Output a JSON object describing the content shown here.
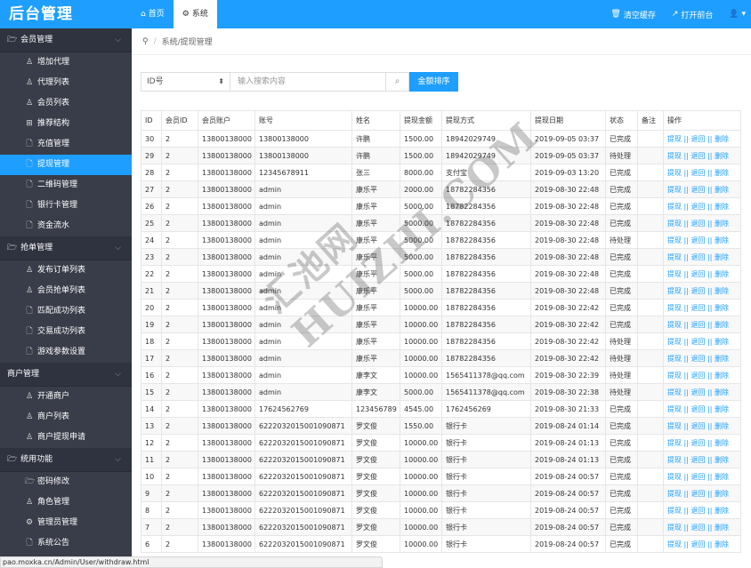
{
  "header": {
    "logo": "后台管理",
    "tabs": [
      {
        "icon": "⌂",
        "label": "首页"
      },
      {
        "icon": "⚙",
        "label": "系统"
      }
    ],
    "clear_cache": "清空缓存",
    "open_frontend": "打开前台",
    "clear_icon": "🗑",
    "open_icon": "↗",
    "user_icon": "👤 ▾"
  },
  "sidebar": {
    "groups": [
      {
        "icon": "🗁",
        "label": "会员管理",
        "items": [
          {
            "icon": "♙",
            "label": "增加代理"
          },
          {
            "icon": "♙",
            "label": "代理列表"
          },
          {
            "icon": "♙",
            "label": "会员列表"
          },
          {
            "icon": "⊞",
            "label": "推荐结构"
          },
          {
            "icon": "🗋",
            "label": "充值管理"
          },
          {
            "icon": "🗋",
            "label": "提现管理"
          },
          {
            "icon": "🗋",
            "label": "二维码管理"
          },
          {
            "icon": "🗋",
            "label": "银行卡管理"
          },
          {
            "icon": "🗋",
            "label": "资金流水"
          }
        ]
      },
      {
        "icon": "🗁",
        "label": "抢单管理",
        "items": [
          {
            "icon": "♙",
            "label": "发布订单列表"
          },
          {
            "icon": "♙",
            "label": "会员抢单列表"
          },
          {
            "icon": "🗋",
            "label": "匹配成功列表"
          },
          {
            "icon": "🗋",
            "label": "交易成功列表"
          },
          {
            "icon": "🗋",
            "label": "游戏参数设置"
          }
        ]
      },
      {
        "icon": "",
        "label": "商户管理",
        "items": [
          {
            "icon": "♙",
            "label": "开通商户"
          },
          {
            "icon": "♙",
            "label": "商户列表"
          },
          {
            "icon": "♙",
            "label": "商户提现申请"
          }
        ]
      },
      {
        "icon": "🗁",
        "label": "统用功能",
        "items": [
          {
            "icon": "🗁",
            "label": "密码修改"
          },
          {
            "icon": "♙",
            "label": "角色管理"
          },
          {
            "icon": "⚙",
            "label": "管理员管理"
          },
          {
            "icon": "🗋",
            "label": "系统公告"
          }
        ]
      }
    ],
    "chevron": "⌵"
  },
  "breadcrumb": {
    "icon": "⚲",
    "sep": "/",
    "path": "系统/提现管理"
  },
  "toolbar": {
    "select_value": "ID号",
    "select_arrow": "⬍",
    "search_placeholder": "输入搜索内容",
    "search_icon": "⌕",
    "sort_label": "金额排序"
  },
  "table": {
    "headers": [
      "ID",
      "会员ID",
      "会员账户",
      "账号",
      "姓名",
      "提现金额",
      "提现方式",
      "提现日期",
      "状态",
      "备注",
      "操作"
    ],
    "ops": "提现 || 退回 || 删除",
    "rows": [
      [
        "30",
        "2",
        "13800138000",
        "13800138000",
        "许鹏",
        "1500.00",
        "18942029749",
        "2019-09-05 03:37",
        "已完成",
        ""
      ],
      [
        "29",
        "2",
        "13800138000",
        "13800138000",
        "许鹏",
        "1500.00",
        "18942029749",
        "2019-09-05 03:37",
        "待处理",
        ""
      ],
      [
        "28",
        "2",
        "13800138000",
        "12345678911",
        "张三",
        "8000.00",
        "支付宝",
        "2019-09-03 13:20",
        "已完成",
        ""
      ],
      [
        "27",
        "2",
        "13800138000",
        "admin",
        "康乐平",
        "2000.00",
        "18782284356",
        "2019-08-30 22:48",
        "已完成",
        ""
      ],
      [
        "26",
        "2",
        "13800138000",
        "admin",
        "康乐平",
        "5000.00",
        "18782284356",
        "2019-08-30 22:48",
        "已完成",
        ""
      ],
      [
        "25",
        "2",
        "13800138000",
        "admin",
        "康乐平",
        "5000.00",
        "18782284356",
        "2019-08-30 22:48",
        "已完成",
        ""
      ],
      [
        "24",
        "2",
        "13800138000",
        "admin",
        "康乐平",
        "5000.00",
        "18782284356",
        "2019-08-30 22:48",
        "待处理",
        ""
      ],
      [
        "23",
        "2",
        "13800138000",
        "admin",
        "康乐平",
        "5000.00",
        "18782284356",
        "2019-08-30 22:48",
        "已完成",
        ""
      ],
      [
        "22",
        "2",
        "13800138000",
        "admin",
        "康乐平",
        "5000.00",
        "18782284356",
        "2019-08-30 22:48",
        "已完成",
        ""
      ],
      [
        "21",
        "2",
        "13800138000",
        "admin",
        "康乐平",
        "5000.00",
        "18782284356",
        "2019-08-30 22:48",
        "已完成",
        ""
      ],
      [
        "20",
        "2",
        "13800138000",
        "admin",
        "康乐平",
        "10000.00",
        "18782284356",
        "2019-08-30 22:42",
        "已完成",
        ""
      ],
      [
        "19",
        "2",
        "13800138000",
        "admin",
        "康乐平",
        "10000.00",
        "18782284356",
        "2019-08-30 22:42",
        "已完成",
        ""
      ],
      [
        "18",
        "2",
        "13800138000",
        "admin",
        "康乐平",
        "10000.00",
        "18782284356",
        "2019-08-30 22:42",
        "待处理",
        ""
      ],
      [
        "17",
        "2",
        "13800138000",
        "admin",
        "康乐平",
        "10000.00",
        "18782284356",
        "2019-08-30 22:42",
        "待处理",
        ""
      ],
      [
        "16",
        "2",
        "13800138000",
        "admin",
        "康李文",
        "10000.00",
        "1565411378@qq.com",
        "2019-08-30 22:39",
        "待处理",
        ""
      ],
      [
        "15",
        "2",
        "13800138000",
        "admin",
        "康李文",
        "5000.00",
        "1565411378@qq.com",
        "2019-08-30 22:38",
        "待处理",
        ""
      ],
      [
        "14",
        "2",
        "13800138000",
        "17624562769",
        "123456789",
        "4545.00",
        "1762456269",
        "2019-08-30 21:33",
        "已完成",
        ""
      ],
      [
        "13",
        "2",
        "13800138000",
        "6222032015001090871",
        "罗文俊",
        "1550.00",
        "银行卡",
        "2019-08-24 01:14",
        "已完成",
        ""
      ],
      [
        "12",
        "2",
        "13800138000",
        "6222032015001090871",
        "罗文俊",
        "10000.00",
        "银行卡",
        "2019-08-24 01:13",
        "已完成",
        ""
      ],
      [
        "11",
        "2",
        "13800138000",
        "6222032015001090871",
        "罗文俊",
        "10000.00",
        "银行卡",
        "2019-08-24 01:13",
        "已完成",
        ""
      ],
      [
        "10",
        "2",
        "13800138000",
        "6222032015001090871",
        "罗文俊",
        "10000.00",
        "银行卡",
        "2019-08-24 00:57",
        "已完成",
        ""
      ],
      [
        "9",
        "2",
        "13800138000",
        "6222032015001090871",
        "罗文俊",
        "10000.00",
        "银行卡",
        "2019-08-24 00:57",
        "已完成",
        ""
      ],
      [
        "8",
        "2",
        "13800138000",
        "6222032015001090871",
        "罗文俊",
        "10000.00",
        "银行卡",
        "2019-08-24 00:57",
        "已完成",
        ""
      ],
      [
        "7",
        "2",
        "13800138000",
        "6222032015001090871",
        "罗文俊",
        "10000.00",
        "银行卡",
        "2019-08-24 00:57",
        "已完成",
        ""
      ],
      [
        "6",
        "2",
        "13800138000",
        "6222032015001090871",
        "罗文俊",
        "10000.00",
        "银行卡",
        "2019-08-24 00:57",
        "已完成",
        ""
      ]
    ]
  },
  "watermark": {
    "cn": "汇池网",
    "en": "HUIZHI.COM"
  },
  "status_url": "pao.moxka.cn/Admin/User/withdraw.html",
  "colors": {
    "accent": "#1e9fff",
    "sidebar_bg": "#393d49",
    "sidebar_group_bg": "#2f3340"
  }
}
